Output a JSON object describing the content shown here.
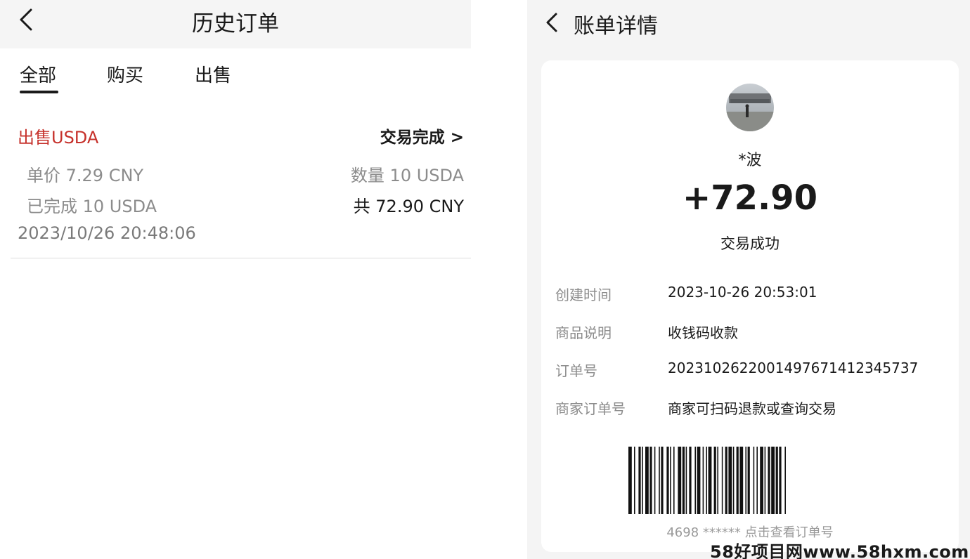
{
  "history": {
    "title": "历史订单",
    "tabs": {
      "all": "全部",
      "buy": "购买",
      "sell": "出售"
    },
    "order": {
      "type": "出售USDA",
      "status": "交易完成 >",
      "unit_price": "单价 7.29 CNY",
      "quantity": "数量 10 USDA",
      "completed": "已完成 10 USDA",
      "total": "共 72.90 CNY",
      "time": "2023/10/26 20:48:06"
    }
  },
  "bill": {
    "title": "账单详情",
    "name": "*波",
    "amount": "+72.90",
    "status": "交易成功",
    "rows": [
      {
        "label": "创建时间",
        "value": "2023-10-26 20:53:01"
      },
      {
        "label": "商品说明",
        "value": "收钱码收款"
      },
      {
        "label": "订单号",
        "value": "2023102622001497671412345737"
      },
      {
        "label": "商家订单号",
        "value": "商家可扫码退款或查询交易"
      }
    ],
    "barcode_caption": "4698 ****** 点击查看订单号"
  },
  "watermark": "58好项目网www.58hxm.com",
  "colors": {
    "accent_red": "#c6312b",
    "header_bg": "#f5f5f5",
    "panel_bg": "#f4f4f4"
  },
  "icons": {
    "back": "chevron-left-icon"
  }
}
